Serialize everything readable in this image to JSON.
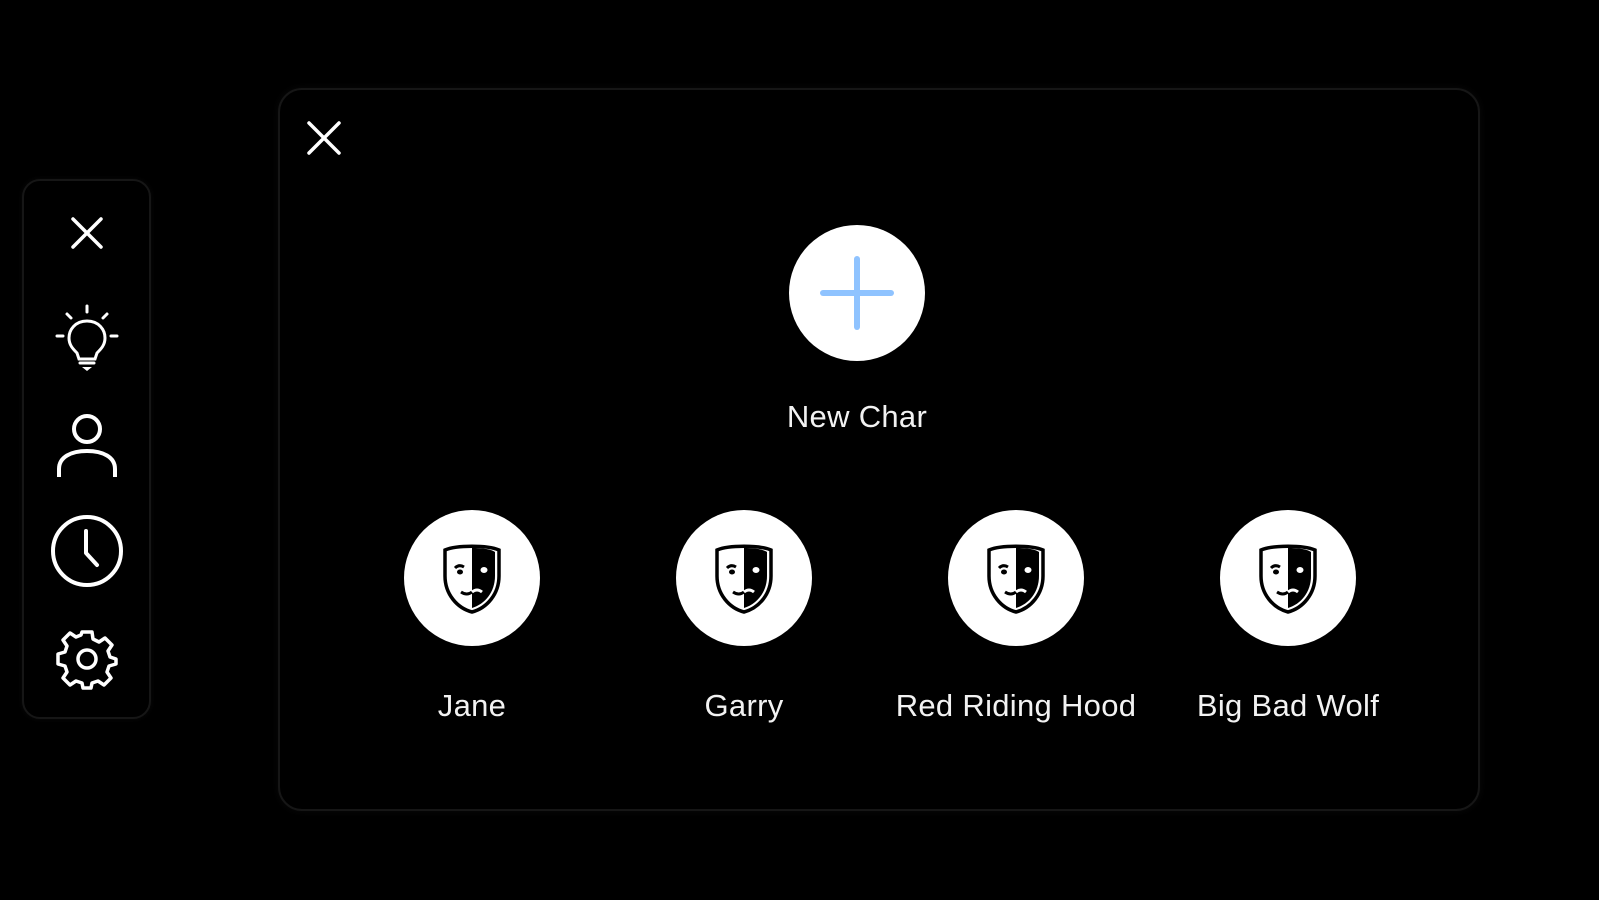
{
  "sidebar": {
    "items": [
      {
        "icon": "close-icon"
      },
      {
        "icon": "lightbulb-icon"
      },
      {
        "icon": "user-icon"
      },
      {
        "icon": "clock-icon"
      },
      {
        "icon": "gear-icon"
      }
    ]
  },
  "panel": {
    "close_icon": "close-icon",
    "new_char": {
      "label": "New Char",
      "icon": "plus-icon",
      "accent_color": "#8fc3ff"
    },
    "characters": [
      {
        "name": "Jane",
        "icon": "drama-mask-icon"
      },
      {
        "name": "Garry",
        "icon": "drama-mask-icon"
      },
      {
        "name": "Red Riding Hood",
        "icon": "drama-mask-icon"
      },
      {
        "name": "Big Bad Wolf",
        "icon": "drama-mask-icon"
      }
    ]
  },
  "colors": {
    "background": "#000000",
    "foreground": "#ffffff",
    "accent": "#8fc3ff"
  }
}
